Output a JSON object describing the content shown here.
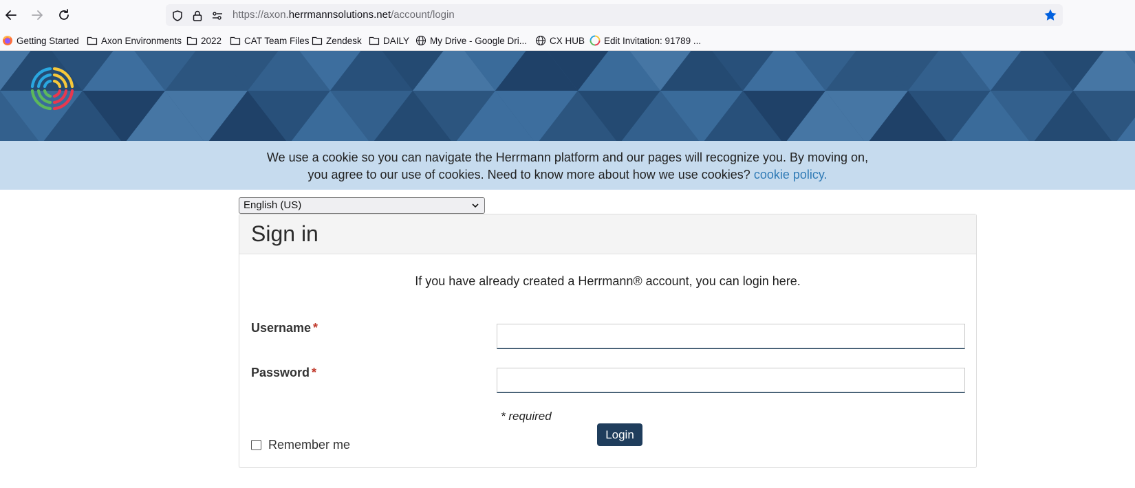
{
  "browser": {
    "url_prefix": "https://axon.",
    "url_host": "herrmannsolutions.net",
    "url_path": "/account/login"
  },
  "bookmarks": [
    {
      "label": "Getting Started",
      "icon": "firefox-icon"
    },
    {
      "label": "Axon Environments",
      "icon": "folder-icon"
    },
    {
      "label": "2022",
      "icon": "folder-icon"
    },
    {
      "label": "CAT Team Files",
      "icon": "folder-icon"
    },
    {
      "label": "Zendesk",
      "icon": "folder-icon"
    },
    {
      "label": "DAILY",
      "icon": "folder-icon"
    },
    {
      "label": "My Drive - Google Dri...",
      "icon": "globe-icon"
    },
    {
      "label": "CX HUB",
      "icon": "globe-icon"
    },
    {
      "label": "Edit Invitation: 91789 ...",
      "icon": "herrmann-logo-icon"
    }
  ],
  "cookie_banner": {
    "line1": "We use a cookie so you can navigate the Herrmann platform and our pages will recognize you. By moving on,",
    "line2": "you agree to our use of cookies. Need to know more about how we use cookies?",
    "link": "cookie policy."
  },
  "language_select": {
    "selected": "English (US)"
  },
  "signin": {
    "title": "Sign in",
    "intro": "If you have already created a Herrmann® account, you can login here.",
    "username_label": "Username",
    "password_label": "Password",
    "required_marker": "*",
    "username_value": "",
    "password_value": "",
    "required_note": "* required",
    "login_button": "Login",
    "remember_label": "Remember me",
    "remember_checked": false
  },
  "colors": {
    "accent": "#1f3d5c",
    "link": "#2f7ab5",
    "cookie_bg": "#c6dbee",
    "banner": "#2f5a86",
    "bookmark_star": "#0060df",
    "required": "#c0392b"
  }
}
